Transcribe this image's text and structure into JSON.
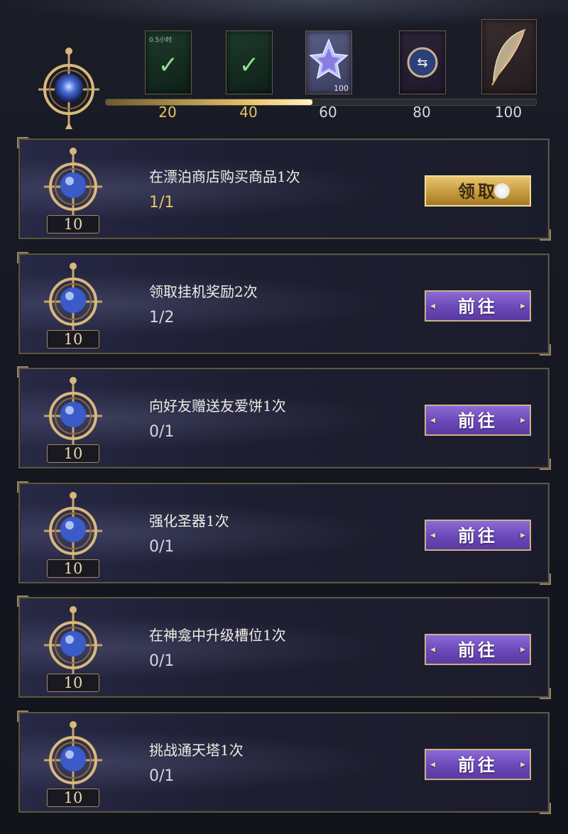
{
  "progress": {
    "fraction": 0.48,
    "milestones": [
      {
        "value": "20",
        "reward_icon": "chest-icon",
        "claimed": true,
        "reward_small_text": "0.5小时"
      },
      {
        "value": "40",
        "reward_icon": "orb-icon",
        "claimed": true
      },
      {
        "value": "60",
        "reward_icon": "crystal-star-icon",
        "claimed": false,
        "reward_count": "100"
      },
      {
        "value": "80",
        "reward_icon": "emblem-icon",
        "claimed": false
      },
      {
        "value": "100",
        "reward_icon": "feather-icon",
        "claimed": false
      }
    ]
  },
  "tasks": [
    {
      "name": "在漂泊商店购买商品1次",
      "progress": "1/1",
      "points": "10",
      "button": "领取",
      "button_type": "claim"
    },
    {
      "name": "领取挂机奖励2次",
      "progress": "1/2",
      "points": "10",
      "button": "前往",
      "button_type": "go"
    },
    {
      "name": "向好友赠送友爱饼1次",
      "progress": "0/1",
      "points": "10",
      "button": "前往",
      "button_type": "go"
    },
    {
      "name": "强化圣器1次",
      "progress": "0/1",
      "points": "10",
      "button": "前往",
      "button_type": "go"
    },
    {
      "name": "在神龛中升级槽位1次",
      "progress": "0/1",
      "points": "10",
      "button": "前往",
      "button_type": "go"
    },
    {
      "name": "挑战通天塔1次",
      "progress": "0/1",
      "points": "10",
      "button": "前往",
      "button_type": "go"
    }
  ],
  "colors": {
    "gold": "#e4c56a",
    "purple_button": "#6a48b8",
    "claim_button": "#c79a3c"
  }
}
